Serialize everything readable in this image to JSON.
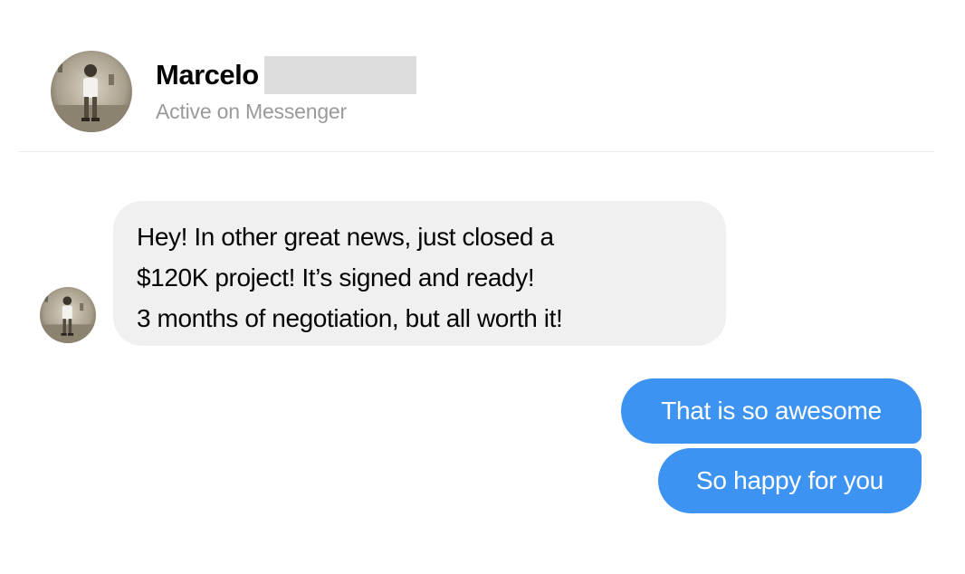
{
  "header": {
    "contact_name": "Marcelo",
    "status": "Active on Messenger"
  },
  "thread": {
    "incoming": {
      "lines": [
        "Hey! In other great news, just closed a",
        "$120K project! It’s signed and ready!",
        "3 months of negotiation, but all worth it!"
      ]
    },
    "outgoing": [
      "That is so awesome",
      "So happy for you"
    ]
  },
  "colors": {
    "outgoing_bubble": "#3d93f2",
    "incoming_bubble": "#f0f0f0",
    "status_text": "#9a9a9a"
  },
  "icons": {
    "header_avatar": "person-photo-avatar",
    "incoming_avatar": "person-photo-avatar"
  }
}
